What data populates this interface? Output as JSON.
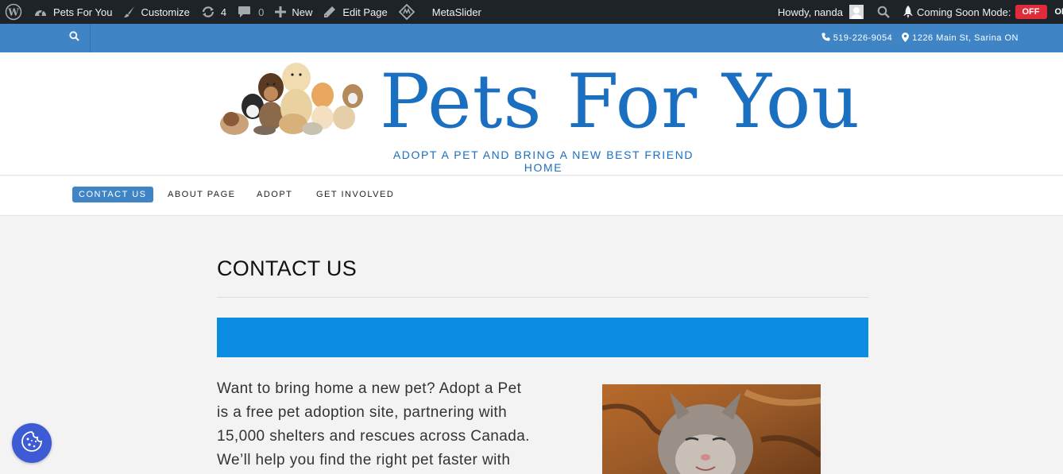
{
  "admin_bar": {
    "site_name": "Pets For You",
    "customize": "Customize",
    "updates_count": "4",
    "comments_count": "0",
    "new": "New",
    "edit_page": "Edit Page",
    "metaslider": "MetaSlider",
    "howdy": "Howdy, nanda",
    "coming_soon_label": "Coming Soon Mode:",
    "coming_soon_state": "OFF",
    "on_text": "ON"
  },
  "topbar": {
    "phone": "519-226-9054",
    "address": "1226 Main St, Sarina ON"
  },
  "header": {
    "title": "Pets For You",
    "tagline": "ADOPT A PET AND BRING A NEW BEST FRIEND HOME"
  },
  "nav": {
    "items": [
      {
        "label": "CONTACT US"
      },
      {
        "label": "ABOUT PAGE"
      },
      {
        "label": "ADOPT"
      },
      {
        "label": "GET INVOLVED"
      }
    ]
  },
  "main": {
    "title": "CONTACT US",
    "lines": [
      "Want to bring home a new pet? Adopt a Pet",
      "is a free pet adoption site, partnering with",
      "15,000 shelters and rescues across Canada.",
      "We’ll help you find the right pet faster with"
    ]
  },
  "colors": {
    "accent": "#3f85c5",
    "title_blue": "#1a6fc0",
    "banner_blue": "#0a8ce0",
    "admin_bg": "#1d2327",
    "off_red": "#e02b3c"
  }
}
